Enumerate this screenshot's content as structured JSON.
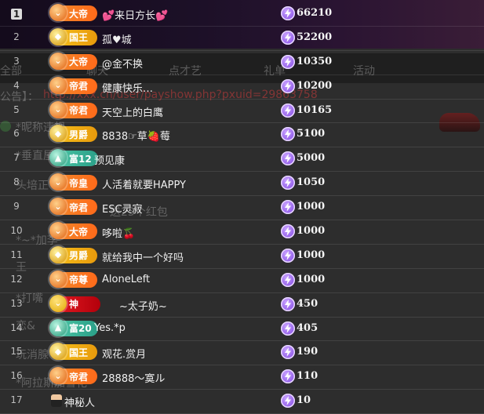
{
  "background": {
    "nav_tabs": [
      "全部",
      "聊天",
      "点才艺",
      "礼单",
      "活动"
    ],
    "notice_label": "公告】：",
    "notice_link": "http://xxx.cn/user/payshow.php?pxuid=29863758",
    "chat_fragments": [
      "*昵称违规",
      "*垂直屋",
      "头培正",
      "送25个红包",
      "加",
      "*~*加李",
      "王",
      "*打嘴",
      "恋&",
      "玩消腺",
      "*阿拉斯加雪花"
    ]
  },
  "colors": {
    "orange_badge": "#f08a2c",
    "gold_badge": "#f6c21c",
    "teal_badge": "#4fc9a8",
    "red_badge": "#e81c24",
    "coin_purple": "#7a3ee0"
  },
  "rows": [
    {
      "rank": "1",
      "badge": "大帝",
      "tier": "orange",
      "nick": "💕来日方长💕",
      "amount": "66210"
    },
    {
      "rank": "2",
      "badge": "国王",
      "tier": "gold",
      "nick": "孤♥城",
      "amount": "52200"
    },
    {
      "rank": "3",
      "badge": "大帝",
      "tier": "orange",
      "nick": "@金不换",
      "amount": "10350"
    },
    {
      "rank": "4",
      "badge": "帝君",
      "tier": "orange",
      "nick": "健康快乐…",
      "amount": "10200"
    },
    {
      "rank": "5",
      "badge": "帝君",
      "tier": "orange",
      "nick": "天空上的白鹰",
      "amount": "10165"
    },
    {
      "rank": "6",
      "badge": "男爵",
      "tier": "gold",
      "nick": "8838☞草🍓莓",
      "amount": "5100"
    },
    {
      "rank": "7",
      "badge": "富12",
      "tier": "teal",
      "nick": "预见康",
      "amount": "5000"
    },
    {
      "rank": "8",
      "badge": "帝皇",
      "tier": "orange",
      "nick": "人活着就要HAPPY",
      "amount": "1050"
    },
    {
      "rank": "9",
      "badge": "帝君",
      "tier": "orange",
      "nick": "ESC灵寂",
      "amount": "1000"
    },
    {
      "rank": "10",
      "badge": "大帝",
      "tier": "orange",
      "nick": "哆啦🍒",
      "amount": "1000"
    },
    {
      "rank": "11",
      "badge": "男爵",
      "tier": "gold",
      "nick": "就给我中一个好吗",
      "amount": "1000"
    },
    {
      "rank": "12",
      "badge": "帝尊",
      "tier": "orange",
      "nick": "AloneLeft",
      "amount": "1000"
    },
    {
      "rank": "13",
      "badge": "神",
      "tier": "red",
      "nick": "~太子奶~",
      "amount": "450"
    },
    {
      "rank": "14",
      "badge": "富20",
      "tier": "teal",
      "nick": "Yes.*p",
      "amount": "405"
    },
    {
      "rank": "15",
      "badge": "国王",
      "tier": "gold",
      "nick": "观花.赏月",
      "amount": "190"
    },
    {
      "rank": "16",
      "badge": "帝君",
      "tier": "orange",
      "nick": "28888～寞ル",
      "amount": "110"
    },
    {
      "rank": "17",
      "badge": "",
      "tier": "none",
      "nick": "神秘人",
      "amount": "10"
    }
  ]
}
